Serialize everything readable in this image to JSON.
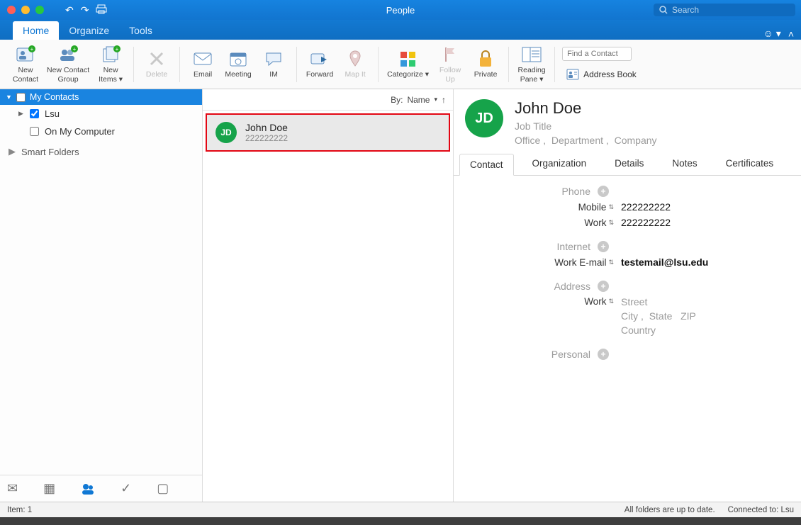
{
  "window_title": "People",
  "search_placeholder": "Search",
  "tabs": {
    "home": "Home",
    "organize": "Organize",
    "tools": "Tools"
  },
  "ribbon": {
    "new_contact": "New\nContact",
    "new_contact_group": "New Contact\nGroup",
    "new_items": "New\nItems",
    "delete": "Delete",
    "email": "Email",
    "meeting": "Meeting",
    "im": "IM",
    "forward": "Forward",
    "map_it": "Map It",
    "categorize": "Categorize",
    "follow_up": "Follow\nUp",
    "private": "Private",
    "reading_pane": "Reading\nPane",
    "find_placeholder": "Find a Contact",
    "address_book": "Address Book"
  },
  "nav": {
    "my_contacts": "My Contacts",
    "lsu": "Lsu",
    "on_my_computer": "On My Computer",
    "smart_folders": "Smart Folders"
  },
  "sort": {
    "label": "By:",
    "field": "Name"
  },
  "list": [
    {
      "initials": "JD",
      "name": "John Doe",
      "sub": "222222222"
    }
  ],
  "detail": {
    "initials": "JD",
    "name": "John  Doe",
    "job_title": "Job Title",
    "office": "Office",
    "department": "Department",
    "company": "Company",
    "tabs": {
      "contact": "Contact",
      "organization": "Organization",
      "details": "Details",
      "notes": "Notes",
      "certificates": "Certificates"
    },
    "sections": {
      "phone": "Phone",
      "internet": "Internet",
      "address": "Address",
      "personal": "Personal"
    },
    "phone": {
      "mobile_label": "Mobile",
      "mobile": "222222222",
      "work_label": "Work",
      "work": "222222222"
    },
    "internet": {
      "work_email_label": "Work E-mail",
      "work_email": "testemail@lsu.edu"
    },
    "address": {
      "work_label": "Work",
      "street": "Street",
      "city": "City",
      "state": "State",
      "zip": "ZIP",
      "country": "Country"
    }
  },
  "status": {
    "item_count": "Item: 1",
    "sync": "All folders are up to date.",
    "conn": "Connected to: Lsu"
  }
}
